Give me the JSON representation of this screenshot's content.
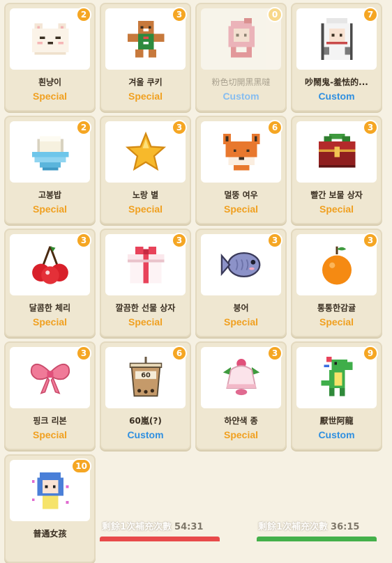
{
  "items": [
    {
      "name": "흰냥이",
      "tag": "Special",
      "type": "special",
      "count": "2",
      "icon": "cat-icon"
    },
    {
      "name": "겨울 쿠키",
      "tag": "Special",
      "type": "special",
      "count": "3",
      "icon": "gingerbread-icon"
    },
    {
      "name": "粉色切開黑黑噠",
      "tag": "Custom",
      "type": "custom",
      "count": "0",
      "icon": "pink-girl-icon"
    },
    {
      "name": "吵鬧鬼-羞怯的...",
      "tag": "Custom",
      "type": "custom",
      "count": "7",
      "icon": "ghost-girl-icon"
    },
    {
      "name": "고봉밥",
      "tag": "Special",
      "type": "special",
      "count": "2",
      "icon": "rice-bowl-icon"
    },
    {
      "name": "노랑 별",
      "tag": "Special",
      "type": "special",
      "count": "3",
      "icon": "star-icon"
    },
    {
      "name": "멀뚱 여우",
      "tag": "Special",
      "type": "special",
      "count": "6",
      "icon": "fox-icon"
    },
    {
      "name": "빨간 보물 상자",
      "tag": "Special",
      "type": "special",
      "count": "3",
      "icon": "treasure-chest-icon"
    },
    {
      "name": "달콤한 체리",
      "tag": "Special",
      "type": "special",
      "count": "3",
      "icon": "cherry-icon"
    },
    {
      "name": "깔끔한 선물 상자",
      "tag": "Special",
      "type": "special",
      "count": "3",
      "icon": "gift-box-icon"
    },
    {
      "name": "붕어",
      "tag": "Special",
      "type": "special",
      "count": "3",
      "icon": "fish-bread-icon"
    },
    {
      "name": "통통한감귤",
      "tag": "Special",
      "type": "special",
      "count": "3",
      "icon": "tangerine-icon"
    },
    {
      "name": "핑크 리본",
      "tag": "Special",
      "type": "special",
      "count": "3",
      "icon": "pink-ribbon-icon"
    },
    {
      "name": "60嵐(?)",
      "tag": "Custom",
      "type": "custom",
      "count": "6",
      "icon": "milk-tea-icon"
    },
    {
      "name": "하얀색 종",
      "tag": "Special",
      "type": "special",
      "count": "3",
      "icon": "white-bell-icon"
    },
    {
      "name": "厭世阿龍",
      "tag": "Custom",
      "type": "custom",
      "count": "9",
      "icon": "dinosaur-icon"
    },
    {
      "name": "普通女孩",
      "tag": "",
      "type": "custom",
      "count": "10",
      "icon": "blue-hair-girl-icon"
    }
  ],
  "timers": [
    {
      "label": "剩餘1次補充次數",
      "time": "54:31"
    },
    {
      "label": "剩餘1次補充次數",
      "time": "36:15"
    }
  ],
  "colors": {
    "special": "#f0a020",
    "custom": "#2f8fe0",
    "badge": "#f5a623",
    "bar_left": "#e84a4a",
    "bar_right": "#44b04a"
  }
}
